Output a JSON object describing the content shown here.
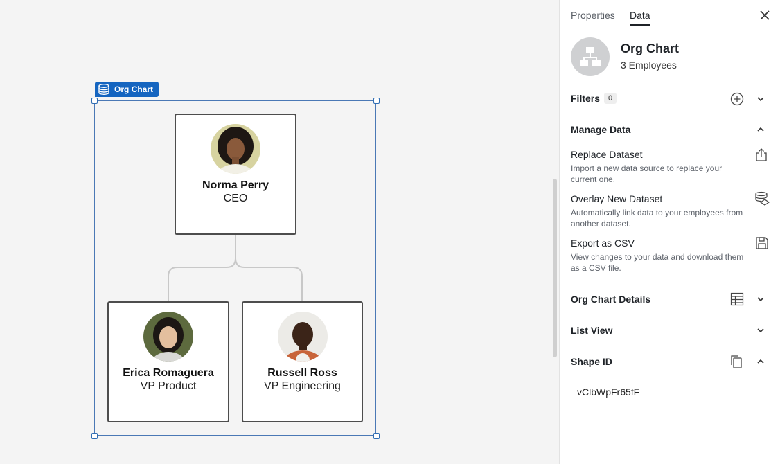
{
  "canvas": {
    "tag_label": "Org Chart",
    "employees": [
      {
        "name": "Norma Perry",
        "role": "CEO"
      },
      {
        "name_first": "Erica ",
        "name_last": "Romaguera",
        "role": "VP Product"
      },
      {
        "name": "Russell Ross",
        "role": "VP Engineering"
      }
    ]
  },
  "panel": {
    "tabs": [
      {
        "label": "Properties",
        "active": false
      },
      {
        "label": "Data",
        "active": true
      }
    ],
    "title": "Org Chart",
    "subtitle": "3 Employees",
    "filters": {
      "label": "Filters",
      "count": "0"
    },
    "manage_data": {
      "label": "Manage Data",
      "items": [
        {
          "title": "Replace Dataset",
          "desc": "Import a new data source to replace your current one.",
          "icon": "upload-icon"
        },
        {
          "title": "Overlay New Dataset",
          "desc": "Automatically link data to your employees from another dataset.",
          "icon": "layers-icon"
        },
        {
          "title": "Export as CSV",
          "desc": "View changes to your data and download them as a CSV file.",
          "icon": "save-icon"
        }
      ]
    },
    "org_chart_details": {
      "label": "Org Chart Details"
    },
    "list_view": {
      "label": "List View"
    },
    "shape_id": {
      "label": "Shape ID",
      "value": "vClbWpFr65fF"
    }
  },
  "colors": {
    "accent": "#1565c0",
    "selection": "#4a78b5",
    "card_border": "#4d4d4d"
  }
}
